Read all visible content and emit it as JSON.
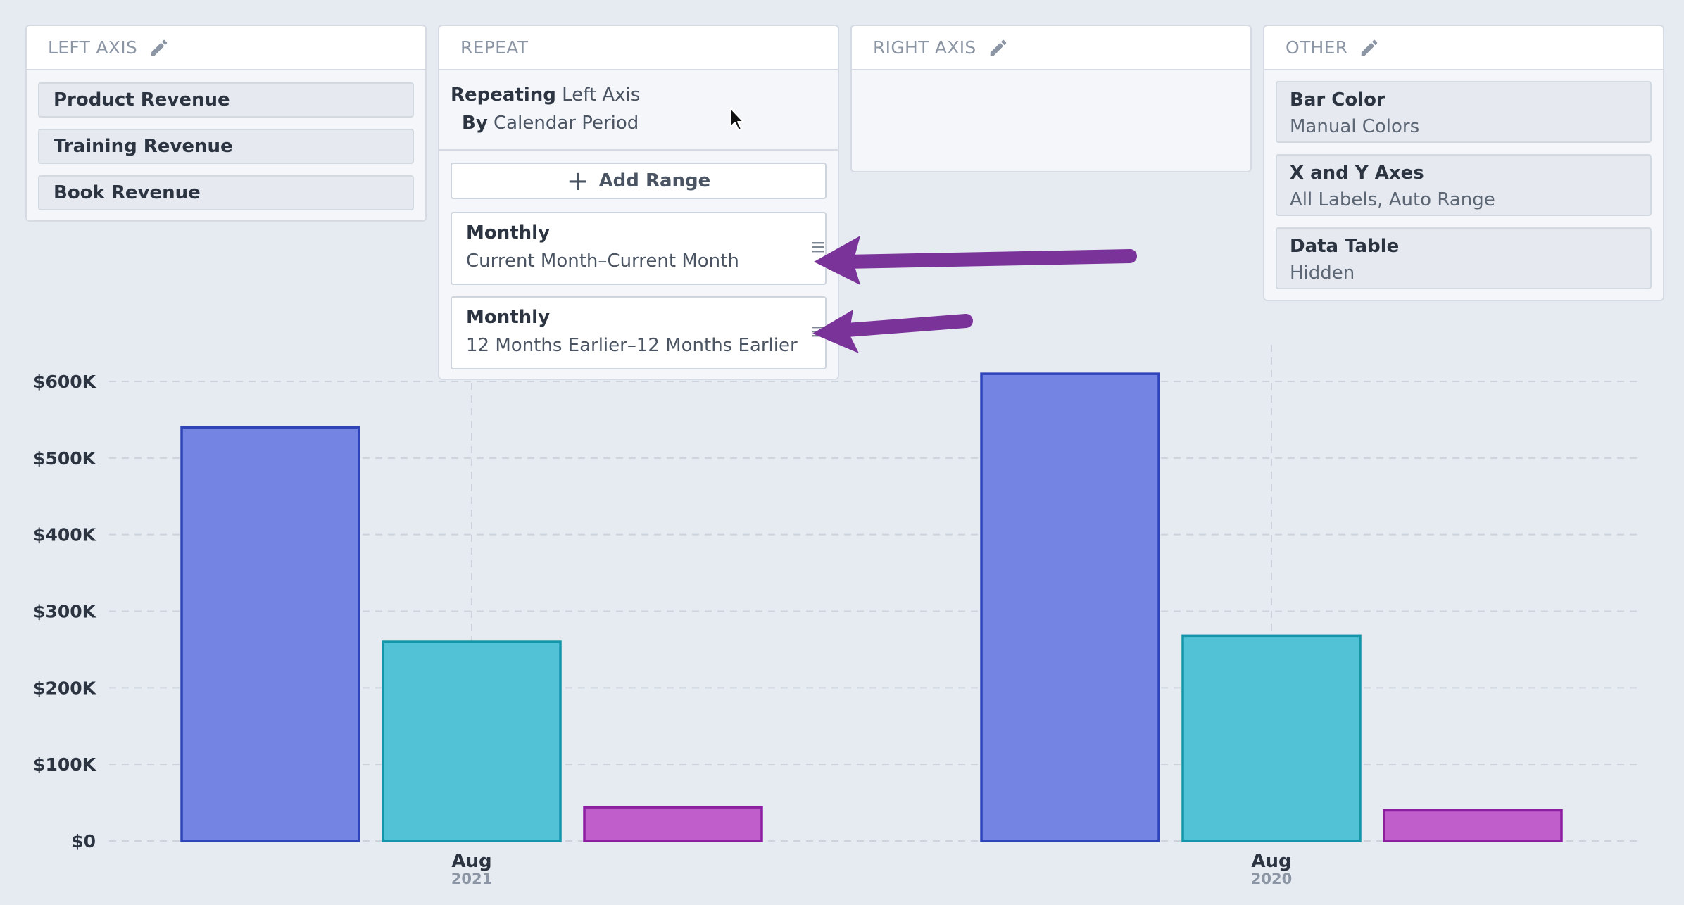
{
  "panels": {
    "left_axis": {
      "title": "LEFT AXIS",
      "icon": "pencil-icon",
      "items": [
        "Product Revenue",
        "Training Revenue",
        "Book Revenue"
      ]
    },
    "repeat": {
      "title": "REPEAT",
      "repeating_label": "Repeating",
      "repeating_value": "Left Axis",
      "by_label": "By",
      "by_value": "Calendar Period",
      "add_range_label": "Add Range",
      "ranges": [
        {
          "title": "Monthly",
          "subtitle": "Current Month–Current Month"
        },
        {
          "title": "Monthly",
          "subtitle": "12 Months Earlier–12 Months Earlier"
        }
      ]
    },
    "right_axis": {
      "title": "RIGHT AXIS",
      "icon": "pencil-icon"
    },
    "other": {
      "title": "OTHER",
      "icon": "pencil-icon",
      "options": [
        {
          "title": "Bar Color",
          "value": "Manual Colors"
        },
        {
          "title": "X and Y Axes",
          "value": "All Labels, Auto Range"
        },
        {
          "title": "Data Table",
          "value": "Hidden"
        }
      ]
    }
  },
  "colors": {
    "product": "#7384e3",
    "product_border": "#2e44b8",
    "training": "#52c2d6",
    "training_border": "#1596a8",
    "book": "#c05fcc",
    "book_border": "#8c1ea0",
    "arrow": "#7a3399"
  },
  "chart_data": {
    "type": "bar",
    "categories": [
      {
        "label": "Aug",
        "sub": "2021"
      },
      {
        "label": "Aug",
        "sub": "2020"
      }
    ],
    "series": [
      {
        "values": [
          540000,
          610000
        ]
      },
      {
        "values": [
          260000,
          268000
        ]
      },
      {
        "values": [
          44000,
          40000
        ]
      }
    ],
    "ylim": [
      0,
      600000
    ],
    "yticks": [
      "$0",
      "$100K",
      "$200K",
      "$300K",
      "$400K",
      "$500K",
      "$600K"
    ],
    "grid": true,
    "legend": "none"
  }
}
